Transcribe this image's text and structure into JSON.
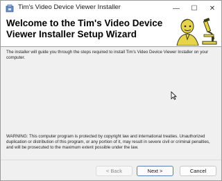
{
  "window": {
    "title": "Tim's Video Device Viewer Installer",
    "minimize_glyph": "—",
    "maximize_glyph": "☐",
    "close_glyph": "✕"
  },
  "banner": {
    "title": "Welcome to the Tim's Video Device Viewer Installer Setup Wizard",
    "art_icon": "scientist-microscope-icon"
  },
  "body": {
    "intro": "The installer will guide you through the steps required to install Tim's Video Device Viewer Installer on your computer.",
    "warning": "WARNING: This computer program is protected by copyright law and international treaties. Unauthorized duplication or distribution of this program, or any portion of it, may result in severe civil or criminal penalties, and will be prosecuted to the maximum extent possible under the law."
  },
  "buttons": {
    "back": "< Back",
    "next": "Next >",
    "cancel": "Cancel"
  },
  "colors": {
    "banner_bg": "#ffffff",
    "dialog_bg": "#f0f0f0",
    "art_yellow": "#e8d44a"
  }
}
